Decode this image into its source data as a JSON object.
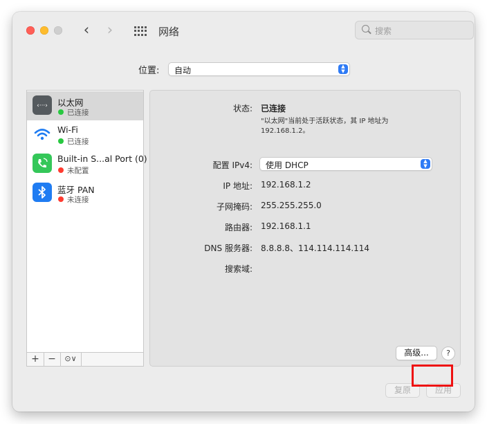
{
  "window": {
    "title": "网络",
    "search_placeholder": "搜索"
  },
  "location": {
    "label": "位置:",
    "value": "自动"
  },
  "services": [
    {
      "name": "以太网",
      "status": "已连接",
      "status_color": "#28c840",
      "icon": "ethernet-icon",
      "selected": true
    },
    {
      "name": "Wi-Fi",
      "status": "已连接",
      "status_color": "#28c840",
      "icon": "wifi-icon",
      "selected": false
    },
    {
      "name": "Built-in S...al Port (0)",
      "status": "未配置",
      "status_color": "#ff3b30",
      "icon": "phone-modem-icon",
      "selected": false
    },
    {
      "name": "蓝牙 PAN",
      "status": "未连接",
      "status_color": "#ff3b30",
      "icon": "bluetooth-icon",
      "selected": false
    }
  ],
  "toolbar": {
    "add": "+",
    "remove": "−",
    "action": "⊙∨"
  },
  "detail": {
    "status_label": "状态:",
    "status_value": "已连接",
    "status_desc": "\"以太网\"当前处于活跃状态，其 IP 地址为 192.168.1.2。",
    "config_label": "配置 IPv4:",
    "config_value": "使用 DHCP",
    "ip_label": "IP 地址:",
    "ip_value": "192.168.1.2",
    "subnet_label": "子网掩码:",
    "subnet_value": "255.255.255.0",
    "router_label": "路由器:",
    "router_value": "192.168.1.1",
    "dns_label": "DNS 服务器:",
    "dns_value": "8.8.8.8、114.114.114.114",
    "search_domain_label": "搜索域:",
    "advanced_button": "高级...",
    "help_button": "?"
  },
  "footer": {
    "revert_button": "复原",
    "apply_button": "应用"
  },
  "colors": {
    "accent": "#2f7bf5",
    "highlight": "#ee1111"
  }
}
